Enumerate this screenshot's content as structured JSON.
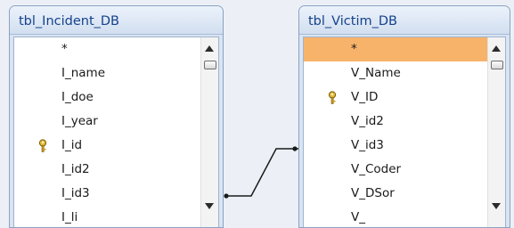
{
  "tables": {
    "incident": {
      "title": "tbl_Incident_DB",
      "fields": [
        "*",
        "I_name",
        "I_doe",
        "I_year",
        "I_id",
        "I_id2",
        "I_id3",
        "I_li"
      ]
    },
    "victim": {
      "title": "tbl_Victim_DB",
      "fields": [
        "*",
        "V_Name",
        "V_ID",
        "V_id2",
        "V_id3",
        "V_Coder",
        "V_DSor",
        "V_"
      ]
    }
  },
  "colors": {
    "selected_row": "#f8b36a",
    "title_text": "#15428b",
    "border": "#8aa2c1"
  },
  "icons": {
    "primary_key": "key-icon",
    "scroll_up": "arrow-up-icon",
    "scroll_down": "arrow-down-icon"
  }
}
